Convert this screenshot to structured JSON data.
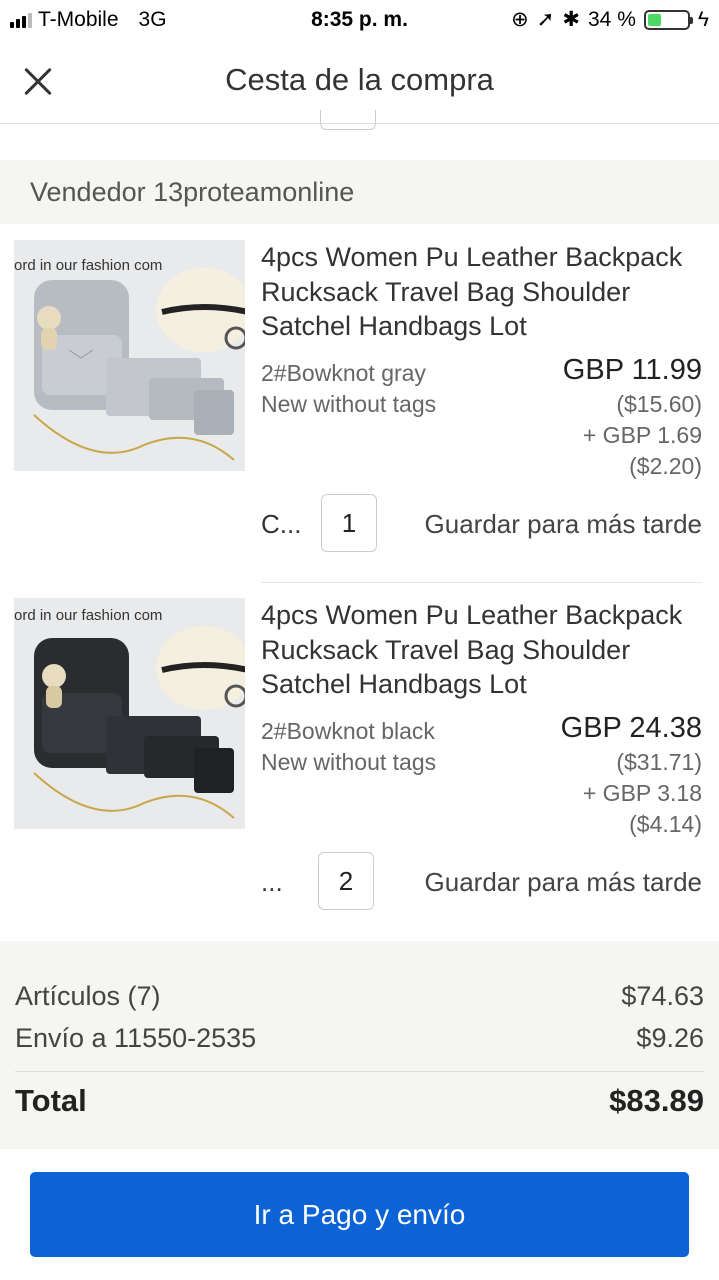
{
  "status_bar": {
    "carrier": "T-Mobile",
    "network": "3G",
    "time": "8:35 p. m.",
    "battery_percent_text": "34 %",
    "battery_level": 0.34
  },
  "header": {
    "title": "Cesta de la compra"
  },
  "seller": {
    "label": "Vendedor 13proteamonline"
  },
  "items": [
    {
      "title": "4pcs Women Pu Leather Backpack Rucksack Travel Bag Shoulder Satchel Handbags Lot",
      "variant": "2#Bowknot gray",
      "condition": "New without tags",
      "price": "GBP 11.99",
      "price_usd": "($15.60)",
      "shipping": "+ GBP 1.69",
      "shipping_usd": "($2.20)",
      "more_label": "C...",
      "quantity": "1",
      "save_label": "Guardar para más tarde",
      "image_color": "gray",
      "image_caption": "ord in our fashion com"
    },
    {
      "title": "4pcs Women Pu Leather Backpack Rucksack Travel Bag Shoulder Satchel Handbags Lot",
      "variant": "2#Bowknot black",
      "condition": "New without tags",
      "price": "GBP 24.38",
      "price_usd": "($31.71)",
      "shipping": "+ GBP 3.18",
      "shipping_usd": "($4.14)",
      "more_label": "...",
      "quantity": "2",
      "save_label": "Guardar para más tarde",
      "image_color": "black",
      "image_caption": "ord in our fashion com"
    }
  ],
  "summary": {
    "items_label": "Artículos (7)",
    "items_value": "$74.63",
    "shipping_label": "Envío a 11550-2535",
    "shipping_value": "$9.26",
    "total_label": "Total",
    "total_value": "$83.89"
  },
  "checkout": {
    "label": "Ir a Pago y envío"
  },
  "colors": {
    "accent": "#0b63d6",
    "band_background": "#f5f5f2",
    "battery_fill": "#4cd964"
  }
}
